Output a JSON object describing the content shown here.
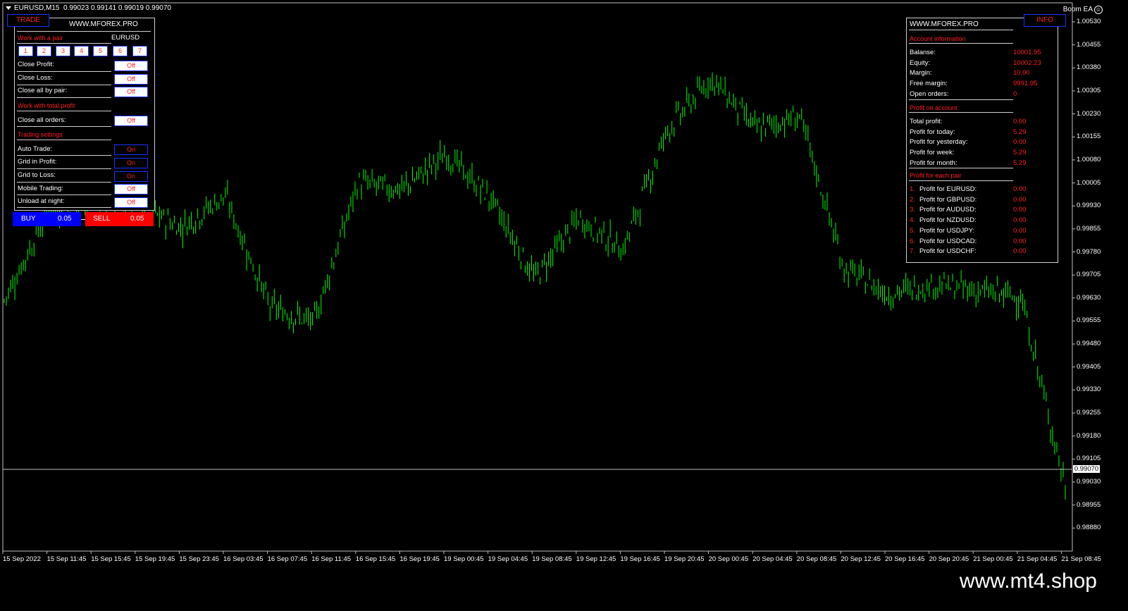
{
  "header": {
    "symbol": "EURUSD,M15",
    "ohlc": "0.99023 0.99141 0.99019 0.99070"
  },
  "ea": {
    "name": "Boom EA"
  },
  "trade_panel": {
    "tab_label": "TRADE",
    "site": "WWW.MFOREX.PRO",
    "section_pair": "Work with a pair",
    "pair": "EURUSD",
    "pair_buttons": [
      "1",
      "2",
      "3",
      "4",
      "5",
      "6",
      "7"
    ],
    "close_profit": {
      "label": "Close Profit:",
      "state": "Off"
    },
    "close_loss": {
      "label": "Close Loss:",
      "state": "Off"
    },
    "close_all_pair": {
      "label": "Close all by pair:",
      "state": "Off"
    },
    "section_total": "Work with total profit",
    "close_all_orders": {
      "label": "Close all orders:",
      "state": "Off"
    },
    "section_settings": "Trading settings",
    "auto_trade": {
      "label": "Auto Trade:",
      "state": "On"
    },
    "grid_profit": {
      "label": "Grid in Profit:",
      "state": "On"
    },
    "grid_loss": {
      "label": "Grid to Loss:",
      "state": "On"
    },
    "mobile": {
      "label": "Mobile Trading:",
      "state": "Off"
    },
    "unload_night": {
      "label": "Unload at night:",
      "state": "Off"
    },
    "buy": {
      "label": "BUY",
      "lot": "0.05"
    },
    "sell": {
      "label": "SELL",
      "lot": "0.05"
    }
  },
  "info_panel": {
    "tab_label": "INFO",
    "site": "WWW.MFOREX.PRO",
    "account_title": "Account information",
    "account": [
      {
        "label": "Balanse:",
        "value": "10001.95"
      },
      {
        "label": "Equity:",
        "value": "10002.23"
      },
      {
        "label": "Margin:",
        "value": "10.00"
      },
      {
        "label": "Free margin:",
        "value": "9991.95"
      },
      {
        "label": "Open orders:",
        "value": "0"
      }
    ],
    "profit_title": "Profit on account",
    "profit": [
      {
        "label": "Total profit:",
        "value": "0.00"
      },
      {
        "label": "Profit for today:",
        "value": "5.29"
      },
      {
        "label": "Profit for yesterday:",
        "value": "0.00"
      },
      {
        "label": "Profit for week:",
        "value": "5.29"
      },
      {
        "label": "Profit for month:",
        "value": "5.29"
      }
    ],
    "pair_title": "Profit for each pair",
    "pairs": [
      {
        "num": "1.",
        "label": "Profit for EURUSD:",
        "value": "0.00"
      },
      {
        "num": "2.",
        "label": "Profit for GBPUSD:",
        "value": "0.00"
      },
      {
        "num": "3.",
        "label": "Profit for AUDUSD:",
        "value": "0.00"
      },
      {
        "num": "4.",
        "label": "Profit for NZDUSD:",
        "value": "0.00"
      },
      {
        "num": "5.",
        "label": "Profit for USDJPY:",
        "value": "0.00"
      },
      {
        "num": "6.",
        "label": "Profit for USDCAD:",
        "value": "0.00"
      },
      {
        "num": "7.",
        "label": "Profit for USDCHF:",
        "value": "0.00"
      }
    ]
  },
  "price_axis": [
    "1.00530",
    "1.00455",
    "1.00380",
    "1.00305",
    "1.00230",
    "1.00155",
    "1.00080",
    "1.00005",
    "0.99930",
    "0.99855",
    "0.99780",
    "0.99705",
    "0.99630",
    "0.99555",
    "0.99480",
    "0.99405",
    "0.99330",
    "0.99255",
    "0.99180",
    "0.99105",
    "0.99030",
    "0.98955",
    "0.98880"
  ],
  "current_price": "0.99070",
  "time_axis": [
    "15 Sep 2022",
    "15 Sep 11:45",
    "15 Sep 15:45",
    "15 Sep 19:45",
    "15 Sep 23:45",
    "16 Sep 03:45",
    "16 Sep 07:45",
    "16 Sep 11:45",
    "16 Sep 15:45",
    "16 Sep 19:45",
    "19 Sep 00:45",
    "19 Sep 04:45",
    "19 Sep 08:45",
    "19 Sep 12:45",
    "19 Sep 16:45",
    "19 Sep 20:45",
    "20 Sep 00:45",
    "20 Sep 04:45",
    "20 Sep 08:45",
    "20 Sep 12:45",
    "20 Sep 16:45",
    "20 Sep 20:45",
    "21 Sep 00:45",
    "21 Sep 04:45",
    "21 Sep 08:45"
  ],
  "watermark": "www.mt4.shop",
  "colors": {
    "candle": "#00ff00",
    "on_bg": "#000000",
    "off_bg": "#ffffff",
    "accent_red": "#ff2020",
    "buy": "#0000ff",
    "sell": "#ff0000"
  },
  "chart_data": {
    "type": "line",
    "description_series": "close",
    "ylim": [
      0.9885,
      1.0056
    ],
    "x": [
      "15 Sep 2022",
      "15 Sep 11:45",
      "15 Sep 15:45",
      "15 Sep 19:45",
      "15 Sep 23:45",
      "16 Sep 03:45",
      "16 Sep 07:45",
      "16 Sep 11:45",
      "16 Sep 15:45",
      "16 Sep 19:45",
      "19 Sep 00:45",
      "19 Sep 04:45",
      "19 Sep 08:45",
      "19 Sep 12:45",
      "19 Sep 16:45",
      "19 Sep 20:45",
      "20 Sep 00:45",
      "20 Sep 04:45",
      "20 Sep 08:45",
      "20 Sep 12:45",
      "20 Sep 16:45",
      "20 Sep 20:45",
      "21 Sep 00:45",
      "21 Sep 04:45",
      "21 Sep 08:45"
    ],
    "series": [
      {
        "values": [
          0.9964,
          0.9992,
          0.9996,
          0.9994,
          0.9987,
          0.9997,
          0.9962,
          0.9957,
          1.0001,
          0.9999,
          1.001,
          0.9996,
          0.9971,
          0.999,
          0.998,
          1.0018,
          1.0034,
          1.0018,
          1.0022,
          0.9974,
          0.9966,
          0.9969,
          0.9967,
          0.9965,
          0.9905
        ]
      }
    ]
  }
}
